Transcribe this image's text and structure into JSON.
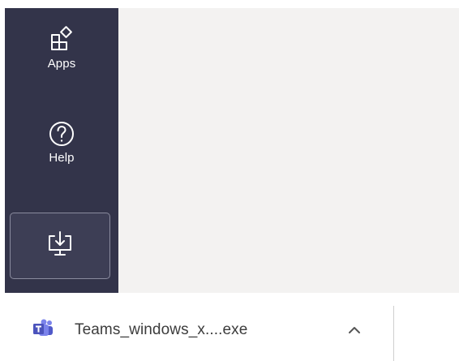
{
  "sidebar": {
    "items": [
      {
        "label": "Apps",
        "icon": "apps-icon"
      },
      {
        "label": "Help",
        "icon": "help-icon"
      }
    ],
    "download_tile": {
      "icon": "download-desktop-icon"
    }
  },
  "download_bar": {
    "file_name": "Teams_windows_x....exe",
    "file_icon": "teams-app-icon",
    "menu_icon": "chevron-up-icon"
  },
  "colors": {
    "sidebar_bg": "#33344a",
    "content_bg": "#f3f2f1",
    "teams_purple": "#5b5fc7"
  }
}
